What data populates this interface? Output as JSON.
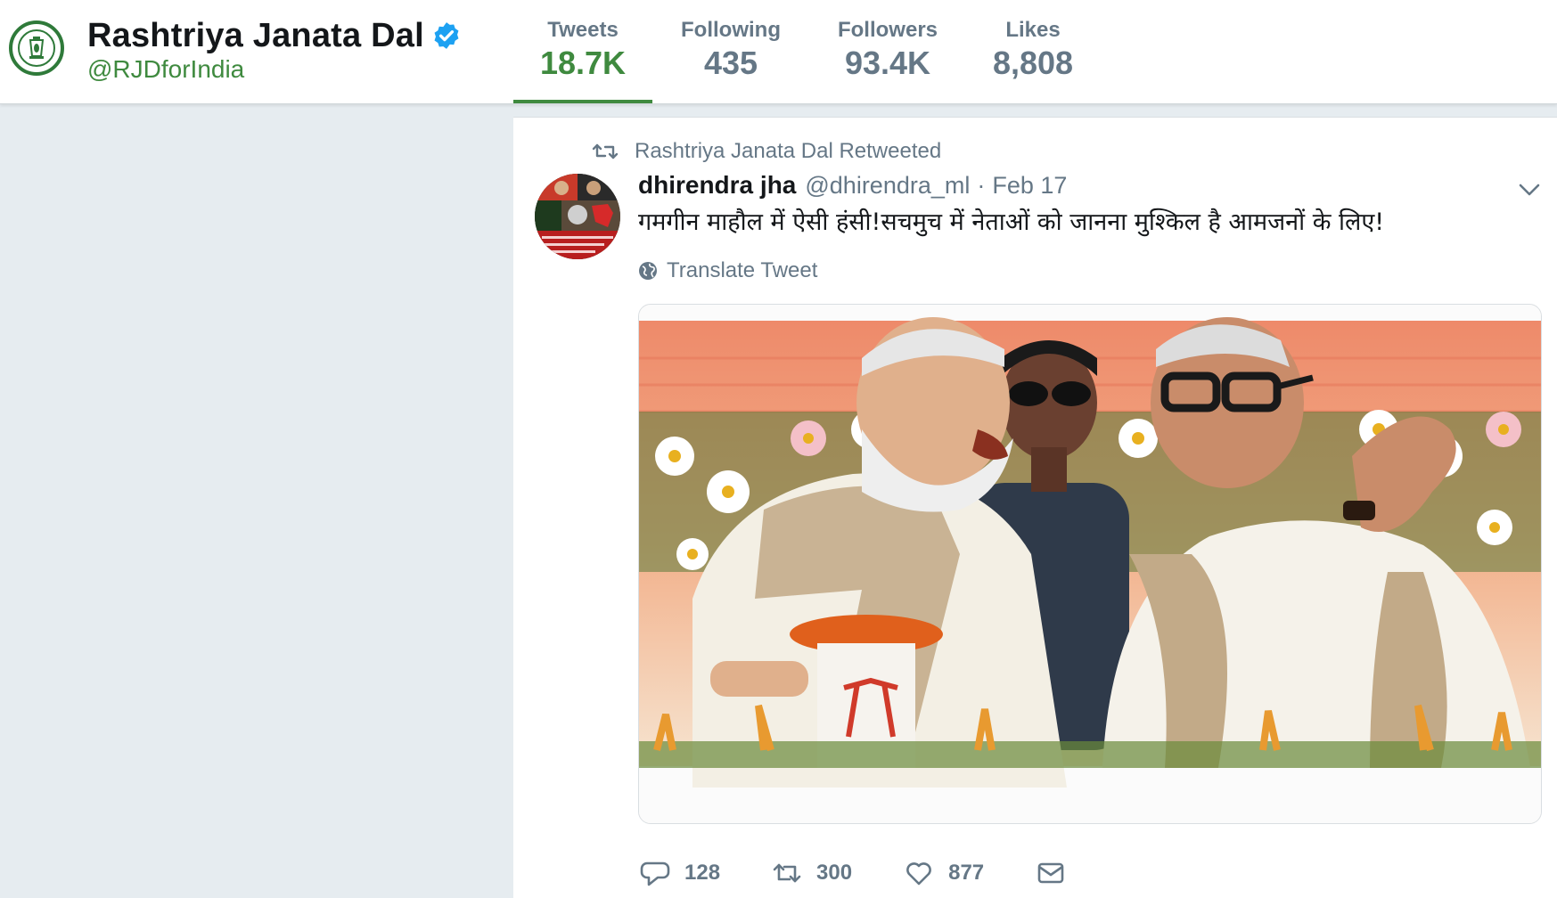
{
  "profile": {
    "name": "Rashtriya Janata Dal",
    "handle": "@RJDforIndia",
    "logo_icon": "lantern-logo",
    "verified_icon": "verified-badge-icon"
  },
  "stats": [
    {
      "label": "Tweets",
      "value": "18.7K",
      "active": true
    },
    {
      "label": "Following",
      "value": "435",
      "active": false
    },
    {
      "label": "Followers",
      "value": "93.4K",
      "active": false
    },
    {
      "label": "Likes",
      "value": "8,808",
      "active": false
    }
  ],
  "tweet": {
    "retweet_notice": "Rashtriya Janata Dal Retweeted",
    "author_name": "dhirendra jha",
    "author_handle": "@dhirendra_ml",
    "separator": "·",
    "date": "Feb 17",
    "text": "गमगीन माहौल में ऐसी हंसी!सचमुच में नेताओं को जानना मुश्किल है आमजनों के लिए!",
    "translate_label": "Translate Tweet",
    "media_description_icon": "photo-two-leaders-laughing",
    "actions": {
      "reply_count": "128",
      "retweet_count": "300",
      "like_count": "877"
    }
  },
  "colors": {
    "accent_green": "#3f8a3f",
    "muted_text": "#657786",
    "page_background": "#e6ecf0"
  }
}
